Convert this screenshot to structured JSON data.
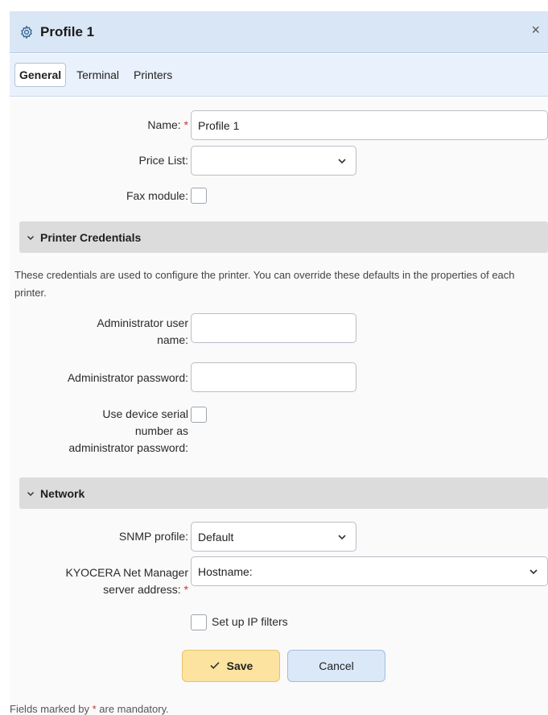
{
  "dialog": {
    "title": "Profile 1",
    "close_symbol": "×"
  },
  "tabs": [
    {
      "label": "General",
      "active": true
    },
    {
      "label": "Terminal",
      "active": false
    },
    {
      "label": "Printers",
      "active": false
    }
  ],
  "general": {
    "name_label": "Name:",
    "required_marker": "*",
    "name_value": "Profile 1",
    "price_list_label": "Price List:",
    "price_list_value": "",
    "fax_label": "Fax module:",
    "fax_checked": false
  },
  "printer_credentials": {
    "title": "Printer Credentials",
    "description": "These credentials are used to configure the printer. You can override these defaults in the properties of each printer.",
    "admin_user_label_line1": "Administrator user",
    "admin_user_label_line2": "name:",
    "admin_user_value": "",
    "admin_password_label": "Administrator password:",
    "admin_password_value": "",
    "serial_label_line1": "Use device serial",
    "serial_label_line2": "number as",
    "serial_label_line3": "administrator password:",
    "serial_checked": false
  },
  "network": {
    "title": "Network",
    "snmp_label": "SNMP profile:",
    "snmp_value": "Default",
    "knm_label_line1": "KYOCERA Net Manager",
    "knm_label_line2": "server address:",
    "knm_value": "Hostname:",
    "ip_filter_label": "Set up IP filters",
    "ip_filter_checked": false
  },
  "buttons": {
    "save_label": "Save",
    "cancel_label": "Cancel"
  },
  "footer": {
    "text_before": "Fields marked by ",
    "marker": "*",
    "text_after": " are mandatory."
  },
  "colors": {
    "titlebar_bg": "#d9e6f5",
    "save_bg": "#fce3a0",
    "cancel_bg": "#dbe8f8",
    "required": "#d03030"
  }
}
